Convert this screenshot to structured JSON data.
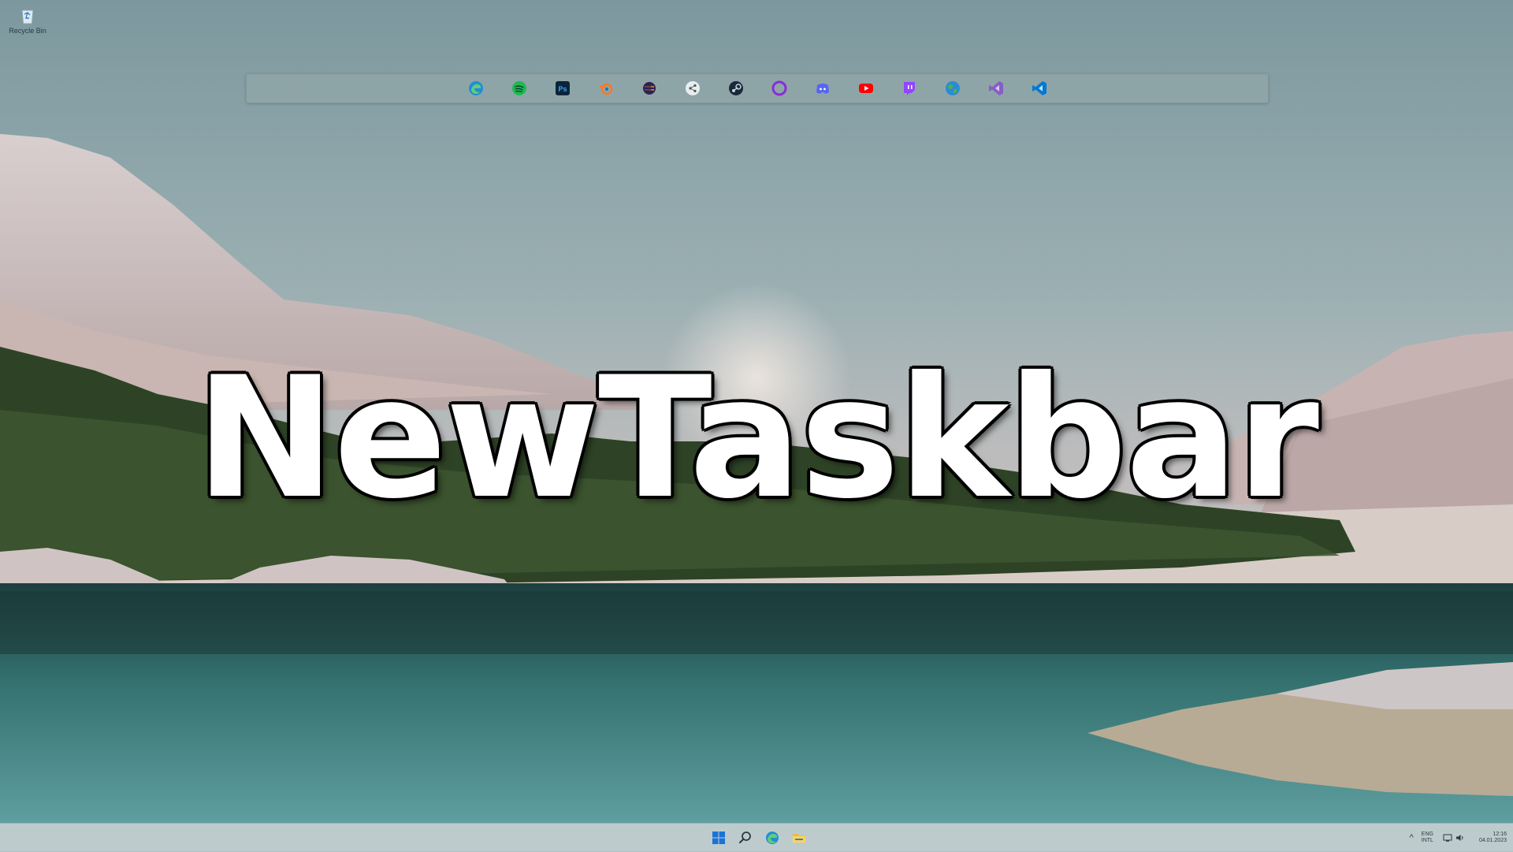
{
  "desktop": {
    "recycle_bin_label": "Recycle Bin"
  },
  "hero": {
    "title": "NewTaskbar"
  },
  "dock": {
    "apps": [
      {
        "name": "edge-icon",
        "color": "#1f8fd6"
      },
      {
        "name": "spotify-icon",
        "color": "#1db954"
      },
      {
        "name": "photoshop-icon",
        "color": "#0d2438"
      },
      {
        "name": "blender-icon",
        "color": "#f5792a"
      },
      {
        "name": "eclipse-icon",
        "color": "#2c2255"
      },
      {
        "name": "share-icon",
        "color": "#e8eef0"
      },
      {
        "name": "steam-icon",
        "color": "#1b2838"
      },
      {
        "name": "circle-app-icon",
        "color": "#8b2bd9"
      },
      {
        "name": "discord-icon",
        "color": "#5865f2"
      },
      {
        "name": "youtube-icon",
        "color": "#ff0000"
      },
      {
        "name": "twitch-icon",
        "color": "#9146ff"
      },
      {
        "name": "globe-icon",
        "color": "#2a8bd6"
      },
      {
        "name": "visual-studio-icon",
        "color": "#865fc5"
      },
      {
        "name": "vscode-icon",
        "color": "#0078d4"
      }
    ]
  },
  "taskbar": {
    "center_items": [
      {
        "name": "start-button-icon"
      },
      {
        "name": "search-icon"
      },
      {
        "name": "edge-taskbar-icon"
      },
      {
        "name": "file-explorer-icon"
      }
    ],
    "tray": {
      "chevron": "^",
      "lang_top": "ENG",
      "lang_bottom": "INTL",
      "time": "12:16",
      "date": "04.01.2023"
    }
  }
}
